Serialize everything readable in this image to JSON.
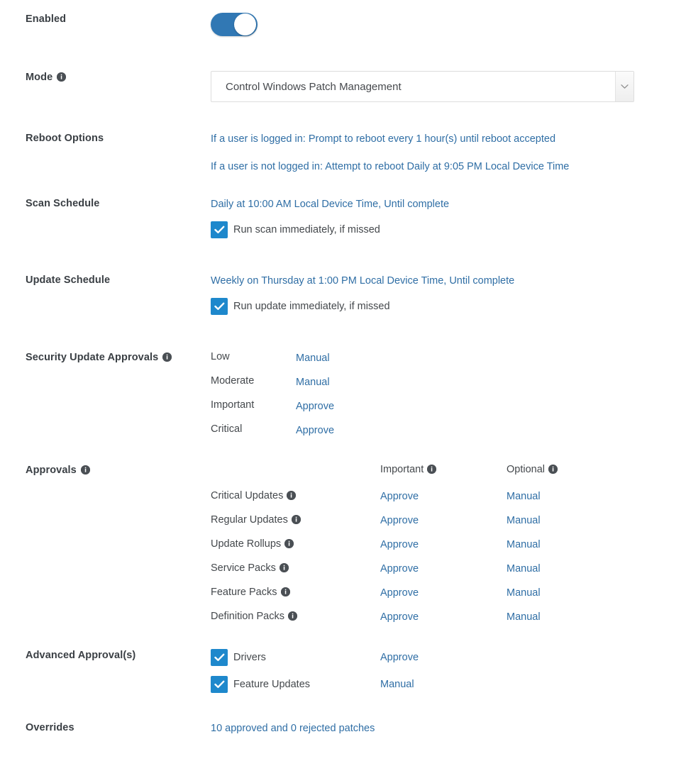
{
  "theme": {
    "link_color": "#2f6ea5",
    "toggle_on_color": "#3178b4",
    "checkbox_color": "#1e88cc",
    "label_color": "#3a3f44",
    "info_icon_color": "#4a4f54",
    "background": "#ffffff"
  },
  "sections": {
    "enabled": {
      "label": "Enabled",
      "toggle_state": "on"
    },
    "mode": {
      "label": "Mode",
      "has_info": true,
      "selected_value": "Control Windows Patch Management",
      "info_icon": "info-icon",
      "chevron_icon": "chevron-down-icon"
    },
    "reboot_options": {
      "label": "Reboot Options",
      "lines": [
        "If a user is logged in: Prompt to reboot every 1 hour(s) until reboot accepted",
        "If a user is not logged in: Attempt to reboot Daily at 9:05 PM Local Device Time"
      ]
    },
    "scan_schedule": {
      "label": "Scan Schedule",
      "schedule_text": "Daily at 10:00 AM Local Device Time, Until complete",
      "checkbox_label": "Run scan immediately, if missed",
      "checkbox_checked": true
    },
    "update_schedule": {
      "label": "Update Schedule",
      "schedule_text": "Weekly on Thursday at 1:00 PM Local Device Time, Until complete",
      "checkbox_label": "Run update immediately, if missed",
      "checkbox_checked": true
    },
    "security_update_approvals": {
      "label": "Security Update Approvals",
      "has_info": true,
      "rows": [
        {
          "name": "Low",
          "value": "Manual"
        },
        {
          "name": "Moderate",
          "value": "Manual"
        },
        {
          "name": "Important",
          "value": "Approve"
        },
        {
          "name": "Critical",
          "value": "Approve"
        }
      ]
    },
    "approvals": {
      "label": "Approvals",
      "has_info": true,
      "columns": [
        {
          "key": "name",
          "header": "",
          "has_info": false
        },
        {
          "key": "important",
          "header": "Important",
          "has_info": true
        },
        {
          "key": "optional",
          "header": "Optional",
          "has_info": true
        }
      ],
      "rows": [
        {
          "name": "Critical Updates",
          "has_info": true,
          "important": "Approve",
          "optional": "Manual"
        },
        {
          "name": "Regular Updates",
          "has_info": true,
          "important": "Approve",
          "optional": "Manual"
        },
        {
          "name": "Update Rollups",
          "has_info": true,
          "important": "Approve",
          "optional": "Manual"
        },
        {
          "name": "Service Packs",
          "has_info": true,
          "important": "Approve",
          "optional": "Manual"
        },
        {
          "name": "Feature Packs",
          "has_info": true,
          "important": "Approve",
          "optional": "Manual"
        },
        {
          "name": "Definition Packs",
          "has_info": true,
          "important": "Approve",
          "optional": "Manual"
        }
      ]
    },
    "advanced_approvals": {
      "label": "Advanced Approval(s)",
      "rows": [
        {
          "name": "Drivers",
          "checked": true,
          "value": "Approve"
        },
        {
          "name": "Feature Updates",
          "checked": true,
          "value": "Manual"
        }
      ]
    },
    "overrides": {
      "label": "Overrides",
      "value": "10 approved and 0 rejected patches"
    }
  }
}
